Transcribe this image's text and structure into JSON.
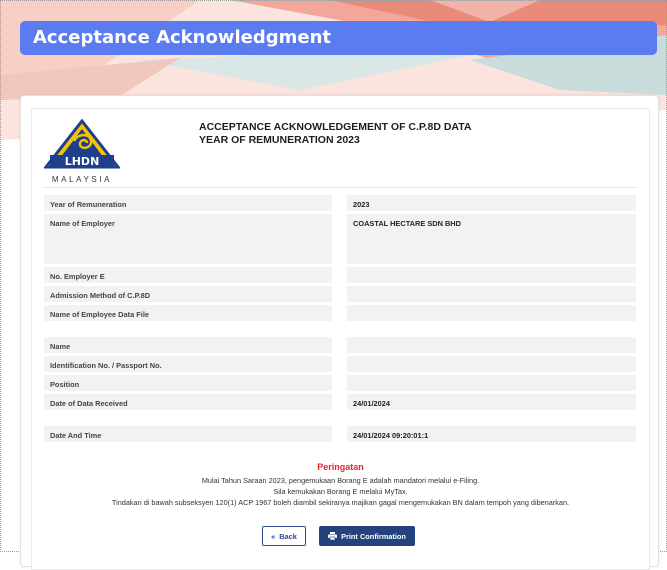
{
  "page": {
    "title": "Acceptance Acknowledgment"
  },
  "logo": {
    "text": "LHDN",
    "sub": "MALAYSIA"
  },
  "document": {
    "heading_line1": "ACCEPTANCE ACKNOWLEDGEMENT OF C.P.8D DATA",
    "heading_line2": "YEAR OF REMUNERATION 2023"
  },
  "fields": {
    "year": {
      "label": "Year of Remuneration",
      "value": "2023"
    },
    "employer_name": {
      "label": "Name of Employer",
      "value": "COASTAL HECTARE SDN BHD"
    },
    "employer_no": {
      "label": "No. Employer E",
      "value": ""
    },
    "admission_method": {
      "label": "Admission Method of C.P.8D",
      "value": ""
    },
    "data_file": {
      "label": "Name of Employee Data File",
      "value": ""
    },
    "name": {
      "label": "Name",
      "value": ""
    },
    "id_no": {
      "label": "Identification No. / Passport No.",
      "value": ""
    },
    "position": {
      "label": "Position",
      "value": ""
    },
    "date_received": {
      "label": "Date of Data Received",
      "value": "24/01/2024"
    },
    "date_time": {
      "label": "Date And Time",
      "value": "24/01/2024 09:20:01:1"
    }
  },
  "notice": {
    "title": "Peringatan",
    "line1": "Mulai Tahun Saraan 2023, pengemukaan Borang E adalah mandatori melalui e-Filing.",
    "line2": "Sila kemukakan Borang E melalui MyTax.",
    "line3": "Tindakan di bawah subseksyen 120(1) ACP 1967 boleh diambil sekiranya majikan gagal mengemukakan BN dalam tempoh yang dibenarkan."
  },
  "buttons": {
    "back": "Back",
    "back_icon": "«",
    "print": "Print Confirmation",
    "print_icon": "printer-icon"
  },
  "colors": {
    "title_bar": "#5b7cf0",
    "button_primary": "#24427d",
    "notice_title": "#e0282e"
  }
}
